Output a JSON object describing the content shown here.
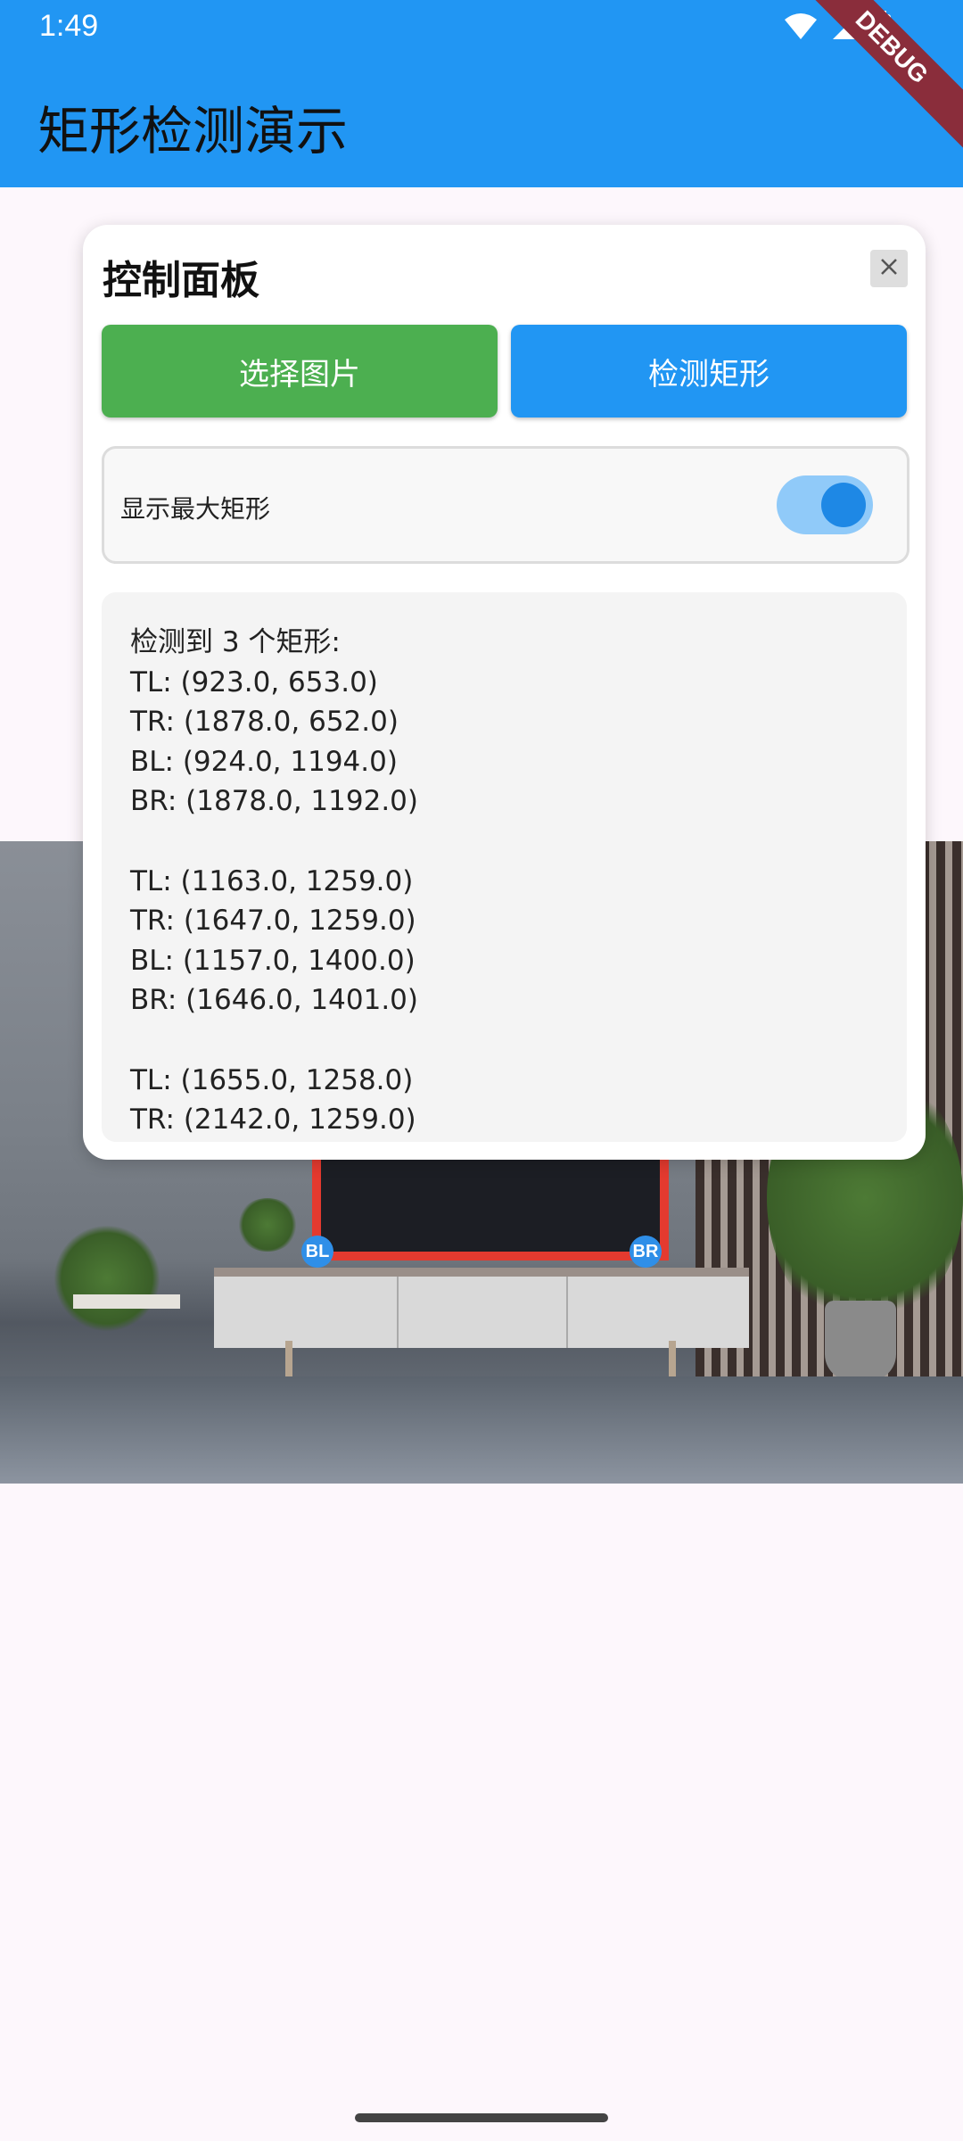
{
  "status_bar": {
    "time": "1:49",
    "icons": [
      "wifi-icon",
      "signal-icon",
      "battery-icon"
    ]
  },
  "app_bar": {
    "title": "矩形检测演示",
    "debug_banner": "DEBUG",
    "color": "#2196f3"
  },
  "panel": {
    "title": "控制面板",
    "close_icon": "close-icon",
    "buttons": {
      "pick_image": "选择图片",
      "detect": "检测矩形"
    },
    "toggle": {
      "label": "显示最大矩形",
      "on": true
    },
    "results_text": "检测到 3 个矩形:\nTL: (923.0, 653.0)\nTR: (1878.0, 652.0)\nBL: (924.0, 1194.0)\nBR: (1878.0, 1192.0)\n\nTL: (1163.0, 1259.0)\nTR: (1647.0, 1259.0)\nBL: (1157.0, 1400.0)\nBR: (1646.0, 1401.0)\n\nTL: (1655.0, 1258.0)\nTR: (2142.0, 1259.0)"
  },
  "image_markers": {
    "bl": "BL",
    "br": "BR"
  },
  "colors": {
    "pick_button": "#4caf50",
    "detect_button": "#2196f3",
    "rect_outline": "#e43a2f",
    "marker": "#2f8fe8"
  }
}
